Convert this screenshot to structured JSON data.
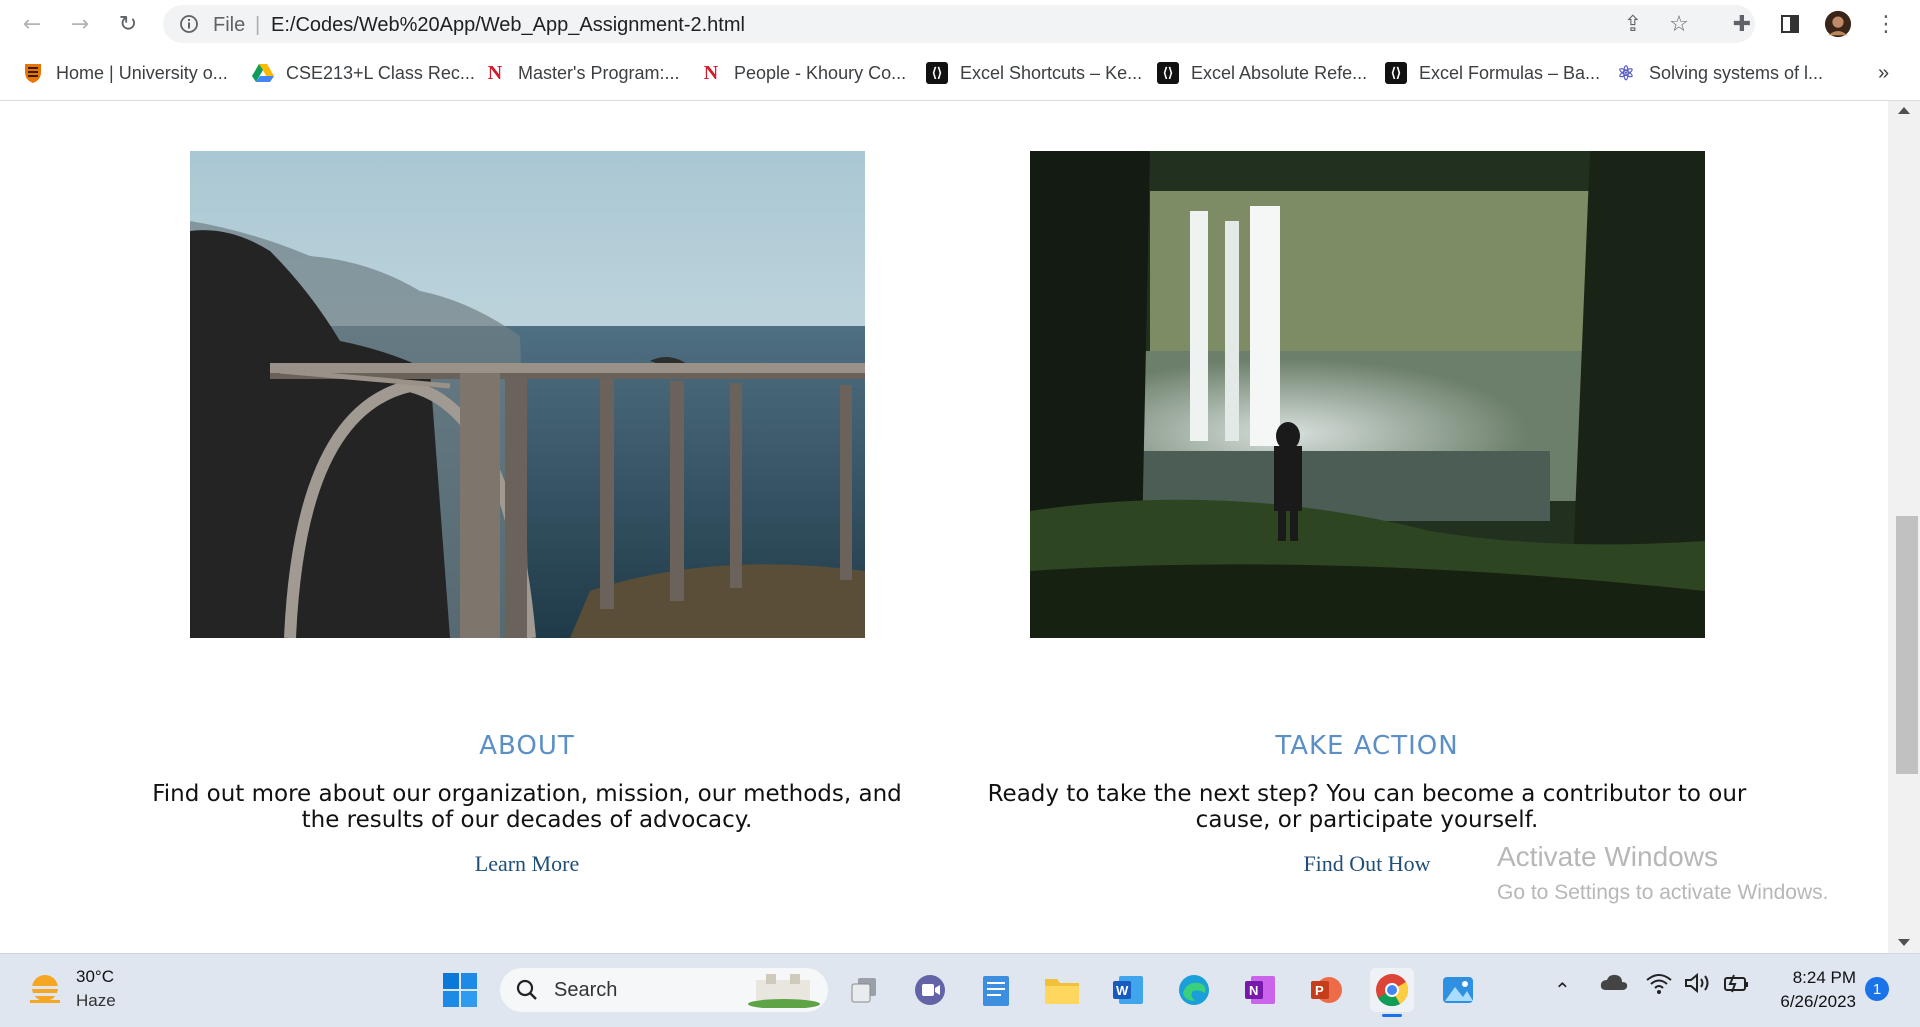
{
  "browser": {
    "scheme": "File",
    "url": "E:/Codes/Web%20App/Web_App_Assignment-2.html",
    "bookmarks": [
      {
        "label": "Home | University o...",
        "icon": "princeton-shield-icon"
      },
      {
        "label": "CSE213+L Class Rec...",
        "icon": "google-drive-icon"
      },
      {
        "label": "Master's Program:...",
        "icon": "northeastern-n-icon"
      },
      {
        "label": "People - Khoury Co...",
        "icon": "northeastern-n-icon"
      },
      {
        "label": "Excel Shortcuts – Ke...",
        "icon": "excel-site-icon"
      },
      {
        "label": "Excel Absolute Refe...",
        "icon": "excel-site-icon"
      },
      {
        "label": "Excel Formulas – Ba...",
        "icon": "excel-site-icon"
      },
      {
        "label": "Solving systems of l...",
        "icon": "atom-icon"
      }
    ],
    "more_bookmarks": "»"
  },
  "page": {
    "about": {
      "title": "ABOUT",
      "text": "Find out more about our organization, mission, our methods, and the results of our decades of advocacy.",
      "link": "Learn More"
    },
    "take_action": {
      "title": "TAKE ACTION",
      "text": "Ready to take the next step? You can become a contributor to our cause, or participate yourself.",
      "link": "Find Out How"
    }
  },
  "watermark": {
    "title": "Activate Windows",
    "subtitle": "Go to Settings to activate Windows."
  },
  "taskbar": {
    "weather_temp": "30°C",
    "weather_desc": "Haze",
    "search_label": "Search",
    "time": "8:24 PM",
    "date": "6/26/2023",
    "notification_count": "1"
  },
  "colors": {
    "heading": "#5b8fc6",
    "link": "#1f4e79",
    "taskbar": "#dfe6ef"
  }
}
